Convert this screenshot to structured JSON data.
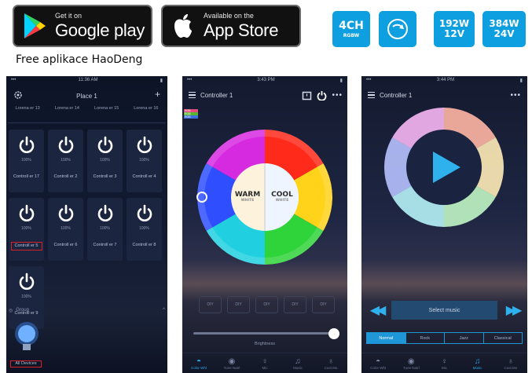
{
  "badges": {
    "google_play": {
      "small": "Get it on",
      "big": "Google play"
    },
    "app_store": {
      "small": "Available on the",
      "big": "App Store"
    }
  },
  "specs": {
    "channels": "4CH",
    "channels_sub": "RGBW",
    "power_12v_w": "192W",
    "power_12v_v": "12V",
    "power_24v_w": "384W",
    "power_24v_v": "24V"
  },
  "section_title": "Free aplikace HaoDeng",
  "colors": {
    "tile_blue": "#0e9fe0",
    "accent_blue": "#29a8ea",
    "selection_red": "#d8202a"
  },
  "phone1": {
    "time": "11:36 AM",
    "title": "Place 1",
    "zones": [
      "Lorena er 13",
      "Lorena er 14",
      "Lorena er 15",
      "Lorena er 16"
    ],
    "devices": [
      {
        "pct": "100%",
        "label": "Controll er 17",
        "selected": false
      },
      {
        "pct": "100%",
        "label": "Controll er 2",
        "selected": false
      },
      {
        "pct": "100%",
        "label": "Controll er 3",
        "selected": false
      },
      {
        "pct": "100%",
        "label": "Controll er 4",
        "selected": false
      },
      {
        "pct": "100%",
        "label": "Controll er 5",
        "selected": true
      },
      {
        "pct": "100%",
        "label": "Controll er 6",
        "selected": false
      },
      {
        "pct": "100%",
        "label": "Controll er 7",
        "selected": false
      },
      {
        "pct": "100%",
        "label": "Controll er 8",
        "selected": false
      },
      {
        "pct": "100%",
        "label": "Controll er 9",
        "selected": false
      }
    ],
    "group_label": "Group",
    "all_devices": "All Devices"
  },
  "phone2": {
    "time": "3:43 PM",
    "title": "Controller 1",
    "modes": [
      "RGB",
      "RGB",
      "RGB"
    ],
    "warm": "WARM",
    "warm_sub": "WHITE",
    "cool": "COOL",
    "cool_sub": "WHITE",
    "scenes": [
      "DIY",
      "DIY",
      "DIY",
      "DIY",
      "DIY"
    ],
    "brightness_label": "Brightness",
    "brightness_level": 0.96,
    "tabs": [
      "Color Whl",
      "Tune Natrl",
      "Mic",
      "Music",
      "Cust.Mo"
    ]
  },
  "phone3": {
    "time": "3:44 PM",
    "title": "Controller 1",
    "select_music": "Select music",
    "genres": [
      "Normal",
      "Rock",
      "Jazz",
      "Classical"
    ],
    "active_genre": "Normal",
    "tabs": [
      "Color Whl",
      "Tune Natrl",
      "Mic",
      "Music",
      "Cust.Mo"
    ]
  }
}
